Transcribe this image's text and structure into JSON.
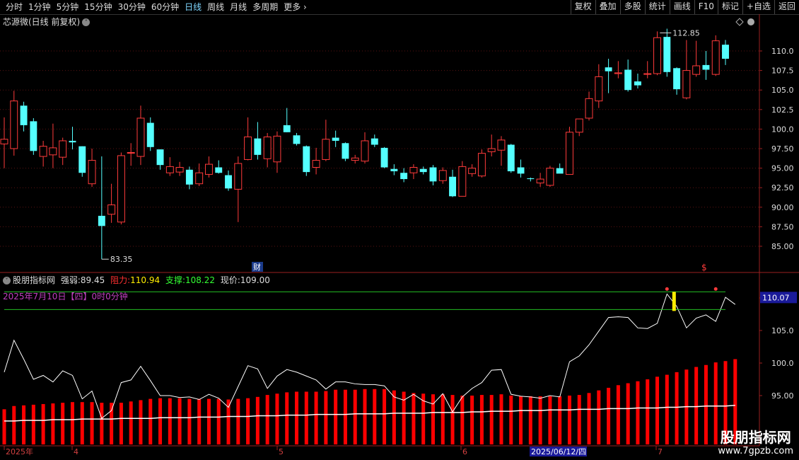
{
  "toolbar": {
    "periods": [
      "分时",
      "1分钟",
      "5分钟",
      "15分钟",
      "30分钟",
      "60分钟",
      "日线",
      "周线",
      "月线",
      "多周期",
      "更多"
    ],
    "active_period": "日线",
    "more_arrow": "›",
    "actions": [
      "复权",
      "叠加",
      "多股",
      "统计",
      "画线",
      "F10",
      "标记",
      "+自选",
      "返回"
    ]
  },
  "main_chart": {
    "title": "芯源微(日线 前复权)",
    "price_axis": [
      "110.0",
      "107.5",
      "105.0",
      "102.5",
      "100.0",
      "97.50",
      "95.00",
      "92.50",
      "90.00",
      "87.50",
      "85.00"
    ],
    "high_label": "112.85",
    "low_label": "83.35",
    "fin_marker": "财",
    "dollar_marker": "$"
  },
  "indicator": {
    "name": "股朋指标网",
    "strength_label": "强弱:",
    "strength_value": "89.45",
    "resistance_label": "阻力:",
    "resistance_value": "110.94",
    "support_label": "支撑:",
    "support_value": "108.22",
    "price_label": "现价:",
    "price_value": "109.00",
    "date_text": "2025年7月10日【四】0时0分钟",
    "axis": [
      "110.0",
      "105.0",
      "100.0",
      "95.00"
    ],
    "current_tag": "110.07"
  },
  "time_axis": {
    "labels": [
      "2025年",
      "4",
      "5",
      "6",
      "7"
    ],
    "highlight": "2025/06/12/四"
  },
  "watermark": {
    "name": "股朋指标网",
    "url": "www.7gpzb.com"
  },
  "colors": {
    "up": "#ff3b3b",
    "down": "#54ffff",
    "line": "#ffffff",
    "band": "#22bb22",
    "bar": "#ff0000"
  },
  "chart_data": {
    "type": "candlestick",
    "price_range": [
      83.35,
      112.85
    ],
    "candles": [
      {
        "o": 98.1,
        "h": 101.5,
        "l": 95.0,
        "c": 98.7
      },
      {
        "o": 97.5,
        "h": 104.9,
        "l": 96.6,
        "c": 103.6
      },
      {
        "o": 103.0,
        "h": 103.5,
        "l": 99.7,
        "c": 100.5
      },
      {
        "o": 101.0,
        "h": 101.4,
        "l": 96.7,
        "c": 97.2
      },
      {
        "o": 96.5,
        "h": 98.5,
        "l": 95.2,
        "c": 97.8
      },
      {
        "o": 96.7,
        "h": 100.7,
        "l": 95.0,
        "c": 97.6
      },
      {
        "o": 96.4,
        "h": 98.9,
        "l": 95.4,
        "c": 98.5
      },
      {
        "o": 98.5,
        "h": 100.3,
        "l": 97.4,
        "c": 98.3
      },
      {
        "o": 97.8,
        "h": 97.8,
        "l": 93.9,
        "c": 94.4
      },
      {
        "o": 93.0,
        "h": 97.5,
        "l": 92.6,
        "c": 96.0
      },
      {
        "o": 88.9,
        "h": 96.5,
        "l": 83.35,
        "c": 87.6
      },
      {
        "o": 89.1,
        "h": 93.0,
        "l": 88.0,
        "c": 90.3
      },
      {
        "o": 88.1,
        "h": 97.0,
        "l": 87.8,
        "c": 96.6
      },
      {
        "o": 97.0,
        "h": 98.2,
        "l": 95.3,
        "c": 97.0
      },
      {
        "o": 96.5,
        "h": 103.0,
        "l": 95.4,
        "c": 101.4
      },
      {
        "o": 100.8,
        "h": 101.5,
        "l": 97.2,
        "c": 97.7
      },
      {
        "o": 97.4,
        "h": 97.4,
        "l": 94.8,
        "c": 95.4
      },
      {
        "o": 94.4,
        "h": 96.4,
        "l": 94.0,
        "c": 95.2
      },
      {
        "o": 94.5,
        "h": 95.8,
        "l": 94.0,
        "c": 95.1
      },
      {
        "o": 94.8,
        "h": 95.2,
        "l": 92.3,
        "c": 92.9
      },
      {
        "o": 93.0,
        "h": 95.6,
        "l": 92.7,
        "c": 94.4
      },
      {
        "o": 94.2,
        "h": 96.5,
        "l": 93.8,
        "c": 95.5
      },
      {
        "o": 95.1,
        "h": 96.0,
        "l": 94.3,
        "c": 94.4
      },
      {
        "o": 94.1,
        "h": 94.7,
        "l": 92.1,
        "c": 92.4
      },
      {
        "o": 92.3,
        "h": 96.5,
        "l": 88.1,
        "c": 95.6
      },
      {
        "o": 96.1,
        "h": 101.5,
        "l": 96.0,
        "c": 99.0
      },
      {
        "o": 98.8,
        "h": 100.9,
        "l": 96.1,
        "c": 96.7
      },
      {
        "o": 96.2,
        "h": 99.5,
        "l": 95.1,
        "c": 99.0
      },
      {
        "o": 95.8,
        "h": 99.7,
        "l": 94.4,
        "c": 99.1
      },
      {
        "o": 100.5,
        "h": 102.7,
        "l": 99.6,
        "c": 99.6
      },
      {
        "o": 99.2,
        "h": 99.5,
        "l": 97.9,
        "c": 98.1
      },
      {
        "o": 97.8,
        "h": 97.9,
        "l": 94.0,
        "c": 94.5
      },
      {
        "o": 95.1,
        "h": 97.6,
        "l": 94.2,
        "c": 96.0
      },
      {
        "o": 96.1,
        "h": 101.2,
        "l": 95.9,
        "c": 98.7
      },
      {
        "o": 98.9,
        "h": 99.8,
        "l": 97.7,
        "c": 98.5
      },
      {
        "o": 98.2,
        "h": 98.3,
        "l": 95.9,
        "c": 96.2
      },
      {
        "o": 96.0,
        "h": 96.7,
        "l": 95.6,
        "c": 96.3
      },
      {
        "o": 95.9,
        "h": 99.6,
        "l": 95.6,
        "c": 98.5
      },
      {
        "o": 98.8,
        "h": 99.3,
        "l": 97.7,
        "c": 98.0
      },
      {
        "o": 97.6,
        "h": 97.7,
        "l": 95.0,
        "c": 95.1
      },
      {
        "o": 94.9,
        "h": 95.5,
        "l": 94.1,
        "c": 94.6
      },
      {
        "o": 94.4,
        "h": 95.0,
        "l": 93.2,
        "c": 93.6
      },
      {
        "o": 94.4,
        "h": 95.5,
        "l": 93.6,
        "c": 95.1
      },
      {
        "o": 94.9,
        "h": 95.2,
        "l": 94.2,
        "c": 94.5
      },
      {
        "o": 95.1,
        "h": 95.4,
        "l": 92.8,
        "c": 93.3
      },
      {
        "o": 93.4,
        "h": 95.1,
        "l": 93.0,
        "c": 94.7
      },
      {
        "o": 93.9,
        "h": 94.8,
        "l": 91.3,
        "c": 91.4
      },
      {
        "o": 91.4,
        "h": 95.9,
        "l": 91.4,
        "c": 95.2
      },
      {
        "o": 94.3,
        "h": 95.5,
        "l": 93.9,
        "c": 95.0
      },
      {
        "o": 94.0,
        "h": 97.4,
        "l": 93.8,
        "c": 96.9
      },
      {
        "o": 97.1,
        "h": 99.3,
        "l": 96.5,
        "c": 97.5
      },
      {
        "o": 97.3,
        "h": 99.1,
        "l": 95.3,
        "c": 98.6
      },
      {
        "o": 98.0,
        "h": 98.1,
        "l": 94.4,
        "c": 94.6
      },
      {
        "o": 95.1,
        "h": 96.1,
        "l": 93.8,
        "c": 94.3
      },
      {
        "o": 93.7,
        "h": 93.8,
        "l": 93.3,
        "c": 93.6
      },
      {
        "o": 93.1,
        "h": 94.4,
        "l": 92.6,
        "c": 93.6
      },
      {
        "o": 92.8,
        "h": 95.3,
        "l": 92.6,
        "c": 95.0
      },
      {
        "o": 95.0,
        "h": 95.6,
        "l": 94.6,
        "c": 94.3
      },
      {
        "o": 94.2,
        "h": 100.3,
        "l": 94.2,
        "c": 99.6
      },
      {
        "o": 99.6,
        "h": 101.2,
        "l": 99.1,
        "c": 101.3
      },
      {
        "o": 101.4,
        "h": 104.8,
        "l": 101.1,
        "c": 103.9
      },
      {
        "o": 103.6,
        "h": 108.3,
        "l": 102.7,
        "c": 106.7
      },
      {
        "o": 107.9,
        "h": 109.0,
        "l": 104.6,
        "c": 107.4
      },
      {
        "o": 107.1,
        "h": 108.7,
        "l": 106.5,
        "c": 107.2
      },
      {
        "o": 107.6,
        "h": 108.9,
        "l": 104.8,
        "c": 105.0
      },
      {
        "o": 106.1,
        "h": 107.1,
        "l": 105.2,
        "c": 105.6
      },
      {
        "o": 107.0,
        "h": 108.7,
        "l": 106.5,
        "c": 107.1
      },
      {
        "o": 107.1,
        "h": 112.5,
        "l": 106.9,
        "c": 111.7
      },
      {
        "o": 111.8,
        "h": 112.85,
        "l": 106.7,
        "c": 107.3
      },
      {
        "o": 107.8,
        "h": 107.9,
        "l": 104.4,
        "c": 105.1
      },
      {
        "o": 104.0,
        "h": 111.4,
        "l": 103.8,
        "c": 107.5
      },
      {
        "o": 107.0,
        "h": 111.3,
        "l": 106.7,
        "c": 108.1
      },
      {
        "o": 108.2,
        "h": 110.0,
        "l": 106.3,
        "c": 107.6
      },
      {
        "o": 107.0,
        "h": 112.0,
        "l": 106.8,
        "c": 111.3
      },
      {
        "o": 110.8,
        "h": 111.4,
        "l": 108.2,
        "c": 109.0
      }
    ],
    "indicator": {
      "range": [
        91.0,
        113.5
      ],
      "strength_line": [
        98.6,
        103.5,
        100.6,
        97.5,
        98.1,
        97.1,
        98.8,
        98.1,
        94.5,
        95.7,
        91.5,
        92.7,
        97.0,
        97.4,
        99.5,
        97.3,
        95.0,
        95.0,
        94.7,
        94.8,
        94.4,
        95.2,
        94.6,
        93.2,
        96.4,
        99.6,
        99.1,
        96.1,
        98.0,
        99.0,
        98.6,
        98.0,
        97.4,
        96.0,
        97.1,
        97.1,
        96.8,
        96.7,
        96.7,
        96.5,
        94.8,
        94.3,
        95.2,
        94.2,
        93.7,
        95.3,
        92.5,
        94.8,
        96.1,
        97.0,
        98.9,
        99.0,
        95.2,
        94.9,
        94.8,
        94.6,
        95.0,
        94.8,
        100.2,
        101.1,
        102.8,
        104.9,
        107.0,
        107.1,
        107.0,
        105.4,
        105.3,
        106.1,
        110.6,
        108.7,
        105.4,
        106.9,
        107.4,
        106.4,
        110.1,
        109.0
      ],
      "bars": [
        92.9,
        93.4,
        93.5,
        93.6,
        93.7,
        93.8,
        93.9,
        94.0,
        94.0,
        94.0,
        93.9,
        93.9,
        93.9,
        94.1,
        94.3,
        94.5,
        94.6,
        94.6,
        94.6,
        94.5,
        94.5,
        94.5,
        94.5,
        94.4,
        94.5,
        94.6,
        94.8,
        95.1,
        95.3,
        95.5,
        95.6,
        95.6,
        95.6,
        95.7,
        95.9,
        95.9,
        95.9,
        96.0,
        96.0,
        96.0,
        95.8,
        95.6,
        95.4,
        95.3,
        95.2,
        95.2,
        95.1,
        95.0,
        95.0,
        95.1,
        95.1,
        95.2,
        95.0,
        94.9,
        94.9,
        94.9,
        94.9,
        94.9,
        95.0,
        95.1,
        95.4,
        95.8,
        96.2,
        96.6,
        96.9,
        97.2,
        97.5,
        97.9,
        98.2,
        98.6,
        99.0,
        99.4,
        99.7,
        100.1,
        100.3,
        100.6
      ],
      "base_line": [
        91.1,
        91.1,
        91.2,
        91.2,
        91.2,
        91.3,
        91.3,
        91.3,
        91.4,
        91.4,
        91.4,
        91.4,
        91.5,
        91.5,
        91.5,
        91.5,
        91.6,
        91.6,
        91.6,
        91.6,
        91.7,
        91.7,
        91.7,
        91.8,
        91.8,
        91.8,
        91.9,
        91.9,
        91.9,
        92.0,
        92.0,
        92.0,
        92.1,
        92.1,
        92.1,
        92.1,
        92.2,
        92.2,
        92.2,
        92.2,
        92.3,
        92.3,
        92.3,
        92.3,
        92.4,
        92.4,
        92.4,
        92.4,
        92.5,
        92.5,
        92.6,
        92.6,
        92.6,
        92.7,
        92.7,
        92.7,
        92.8,
        92.8,
        92.8,
        92.9,
        92.9,
        92.9,
        93.0,
        93.0,
        93.0,
        93.1,
        93.1,
        93.1,
        93.2,
        93.2,
        93.3,
        93.3,
        93.4,
        93.4,
        93.4,
        93.5
      ],
      "resistance": 110.94,
      "support": 108.22,
      "current": 110.07
    }
  }
}
